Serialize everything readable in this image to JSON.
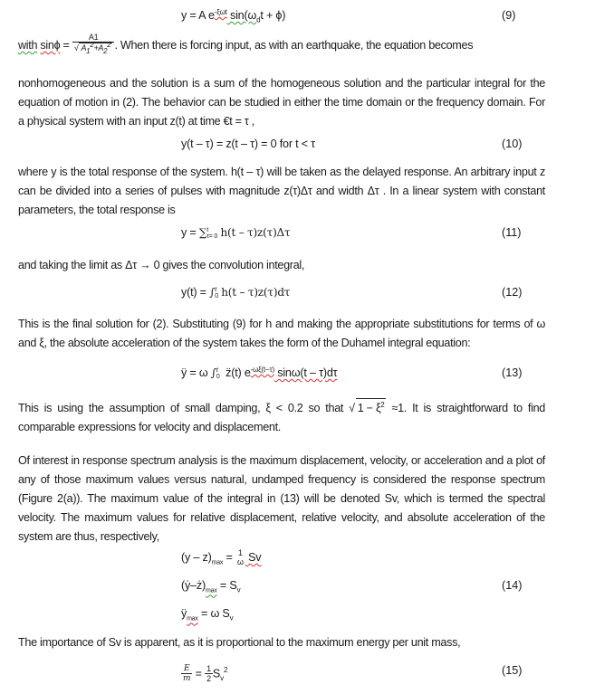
{
  "equations": {
    "eq9": {
      "lhs": "y = A e",
      "exp": "-ξωt",
      "rest_a": " sin(ω",
      "sub": "d",
      "rest_b": "t + ϕ)",
      "number": "(9)"
    },
    "eq10": {
      "text": "y(t – τ) = z(t – τ) = 0 for t < τ",
      "number": "(10)"
    },
    "eq11": {
      "lhs": "y = ",
      "sum": "∑",
      "sup": "t",
      "sub": "τ= 0",
      "rest": "h(t – τ)z(τ)Δτ",
      "number": "(11)"
    },
    "eq12": {
      "lhs": "y(t) = ",
      "int": "∫",
      "sup": "t",
      "sub": "0",
      "rest": "h(t –  τ)z(τ)dτ",
      "number": "(12)"
    },
    "eq13": {
      "lhs": "ÿ = ω ",
      "int": "∫",
      "sup": "t",
      "sub": "0",
      "zdd": "z̈(t) e",
      "exp": "-ωξ(t−τ)",
      "rest": " sinω(t – τ)dτ",
      "number": "(13)"
    },
    "eq14": {
      "line1": {
        "lhs": "(y – z)",
        "sub": "max",
        "eq": " = ",
        "num": "1",
        "den": "ω",
        "rhs": " Sv"
      },
      "line2": {
        "lhs": "(ẏ–ż)",
        "sub": "max",
        "eq": " = S",
        "rhs_sub": "v"
      },
      "line3": {
        "lhs": "ÿ",
        "sub": "max",
        "eq": " = ω S",
        "rhs_sub": "v"
      },
      "number": "(14)"
    },
    "eq15": {
      "num_l": "E",
      "den_l": "m",
      "eq": " = ",
      "num_r": "1",
      "den_r": "2",
      "rhs": "S",
      "rhs_sub": "v",
      "rhs_sup": "2",
      "number": "(15)"
    }
  },
  "paragraphs": {
    "p1": {
      "with": "with",
      "sinphi": "sinϕ",
      "eq": " = ",
      "frac_num": "A1",
      "frac_den_a": "A",
      "frac_den_a_sub": "1",
      "frac_den_plus": "+A",
      "frac_den_b_sub": "2",
      "frac_sup": "2",
      "after": ". When there is forcing input, as with an earthquake, the equation becomes",
      "line2": "nonhomogeneous and the solution is a sum of the homogeneous solution and the particular integral for the equation of motion in (2). The behavior can be studied in either the time domain or the frequency domain. For a physical system with an input z(t) at time €t = τ ,"
    },
    "p2": "where y is the total response of the system.  h(t – τ) will be taken as the delayed response. An arbitrary input z can be divided into a series of pulses with magnitude z(τ)Δτ and width Δτ . In a linear system with constant parameters, the total response is",
    "p3": "and taking the limit as Δτ → 0 gives the convolution integral,",
    "p4": "This is the final solution for (2). Substituting (9) for h and making the appropriate substitutions for terms of ω and ξ, the absolute acceleration of the system takes the form of the Duhamel integral equation:",
    "p5": {
      "before": "This is using the assumption of small damping, ξ < 0.2 so that ",
      "sqrt": "1 − ξ",
      "sqrt_sup": "2",
      "after": " ≈1. It is straightforward to find comparable expressions for velocity and displacement."
    },
    "p6": "Of interest in response spectrum analysis is the maximum displacement, velocity, or acceleration and a plot of any of those maximum values versus natural, undamped frequency is considered the response spectrum (Figure 2(a)). The maximum value of the integral in (13) will be denoted Sv, which is termed the spectral velocity. The maximum values for relative displacement, relative velocity, and absolute acceleration of the system are thus, respectively,",
    "p7": "The importance of Sv is apparent, as it is proportional to the maximum energy per unit mass,"
  }
}
